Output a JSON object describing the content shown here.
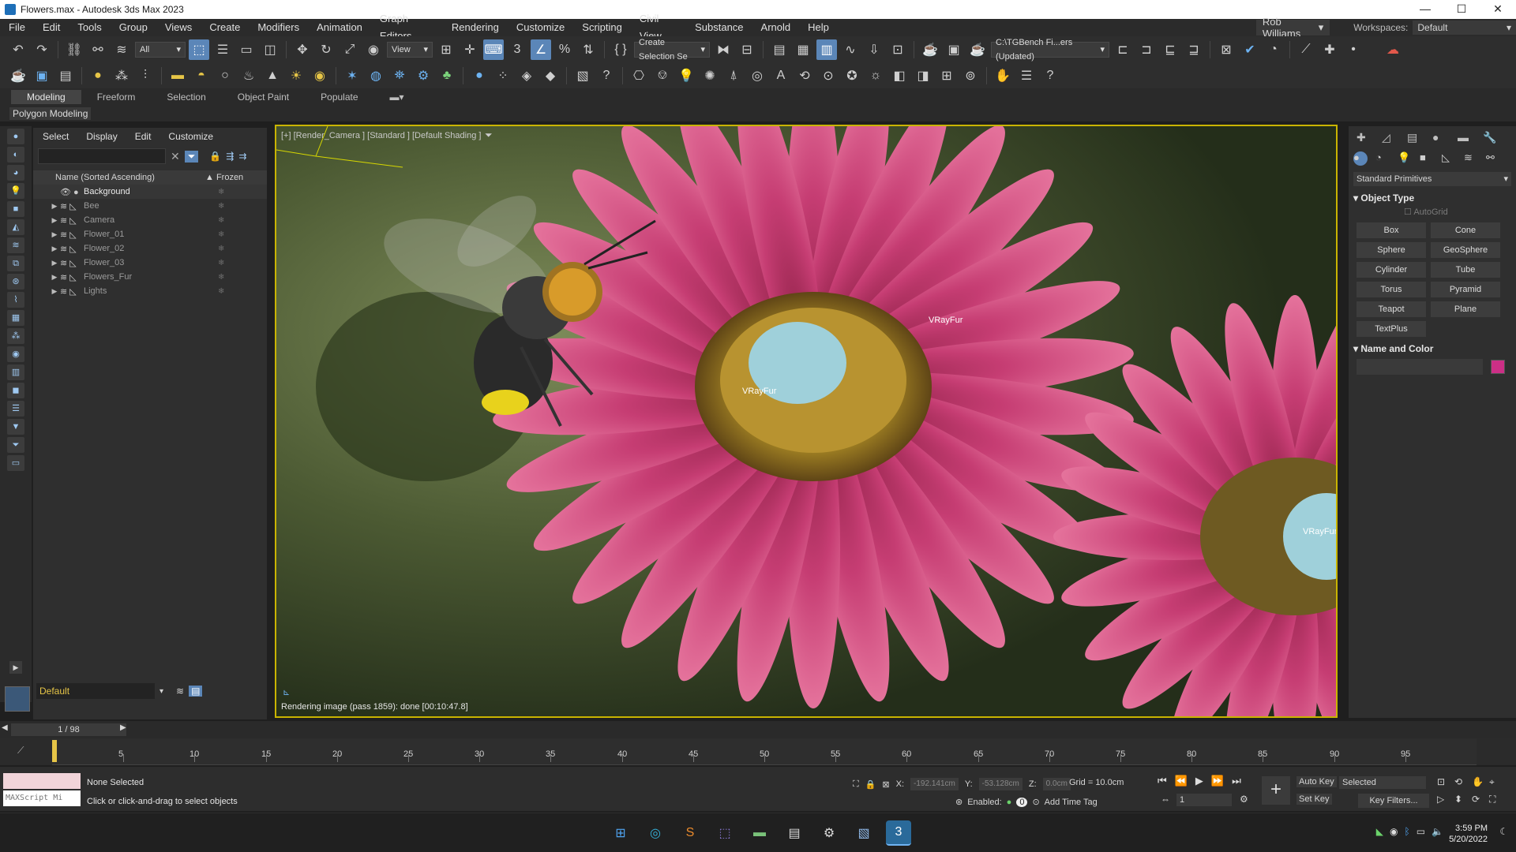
{
  "window": {
    "title": "Flowers.max - Autodesk 3ds Max 2023",
    "min": "—",
    "max": "☐",
    "close": "✕"
  },
  "menu": {
    "items": [
      "File",
      "Edit",
      "Tools",
      "Group",
      "Views",
      "Create",
      "Modifiers",
      "Animation",
      "Graph Editors",
      "Rendering",
      "Customize",
      "Scripting",
      "Civil View",
      "Substance",
      "Arnold",
      "Help"
    ],
    "user": "Rob Williams",
    "workspaces_label": "Workspaces:",
    "workspace": "Default"
  },
  "toolbar1": {
    "filter": "All",
    "ref_coord": "View",
    "selection_set": "Create Selection Se",
    "project_path": "C:\\TGBench Fi...ers (Updated)"
  },
  "ribbon": {
    "tabs": [
      "Modeling",
      "Freeform",
      "Selection",
      "Object Paint",
      "Populate"
    ],
    "active": "Modeling",
    "sub": "Polygon Modeling"
  },
  "explorer": {
    "menu": [
      "Select",
      "Display",
      "Edit",
      "Customize"
    ],
    "col_name": "Name (Sorted Ascending)",
    "col_frozen": "▲ Frozen",
    "rows": [
      {
        "name": "Background",
        "expandable": false
      },
      {
        "name": "Bee",
        "expandable": true
      },
      {
        "name": "Camera",
        "expandable": true
      },
      {
        "name": "Flower_01",
        "expandable": true
      },
      {
        "name": "Flower_02",
        "expandable": true
      },
      {
        "name": "Flower_03",
        "expandable": true
      },
      {
        "name": "Flowers_Fur",
        "expandable": true
      },
      {
        "name": "Lights",
        "expandable": true
      }
    ],
    "layer": "Default"
  },
  "viewport": {
    "label": "[+] [Render_Camera ] [Standard ] [Default Shading ]",
    "status": "Rendering image (pass 1859): done [00:10:47.8]",
    "fur_labels": [
      "VRayFur",
      "VRayFur",
      "VRayFur"
    ]
  },
  "command_panel": {
    "category": "Standard Primitives",
    "object_type": "Object Type",
    "autogrid": "AutoGrid",
    "buttons": [
      "Box",
      "Cone",
      "Sphere",
      "GeoSphere",
      "Cylinder",
      "Tube",
      "Torus",
      "Pyramid",
      "Teapot",
      "Plane",
      "TextPlus"
    ],
    "name_and_color": "Name and Color",
    "color": "#cc2f86"
  },
  "timeline": {
    "frame_display": "1 / 98",
    "ticks": [
      "5",
      "10",
      "15",
      "20",
      "25",
      "30",
      "35",
      "40",
      "45",
      "50",
      "55",
      "60",
      "65",
      "70",
      "75",
      "80",
      "85",
      "90",
      "95"
    ]
  },
  "status": {
    "maxscript": "MAXScript Mi",
    "selection": "None Selected",
    "prompt": "Click or click-and-drag to select objects",
    "x": "-192.141cm",
    "y": "-53.128cm",
    "z": "0.0cm",
    "grid": "Grid = 10.0cm",
    "enabled": "Enabled:",
    "enabled_count": "0",
    "add_time_tag": "Add Time Tag",
    "frame": "1",
    "auto_key": "Auto Key",
    "set_key": "Set Key",
    "selected": "Selected",
    "key_filters": "Key Filters..."
  },
  "taskbar": {
    "time": "3:59 PM",
    "date": "5/20/2022"
  },
  "colors": {
    "accent": "#5b86b8",
    "viewport_border": "#c9b400",
    "layer": "#e6c547"
  }
}
